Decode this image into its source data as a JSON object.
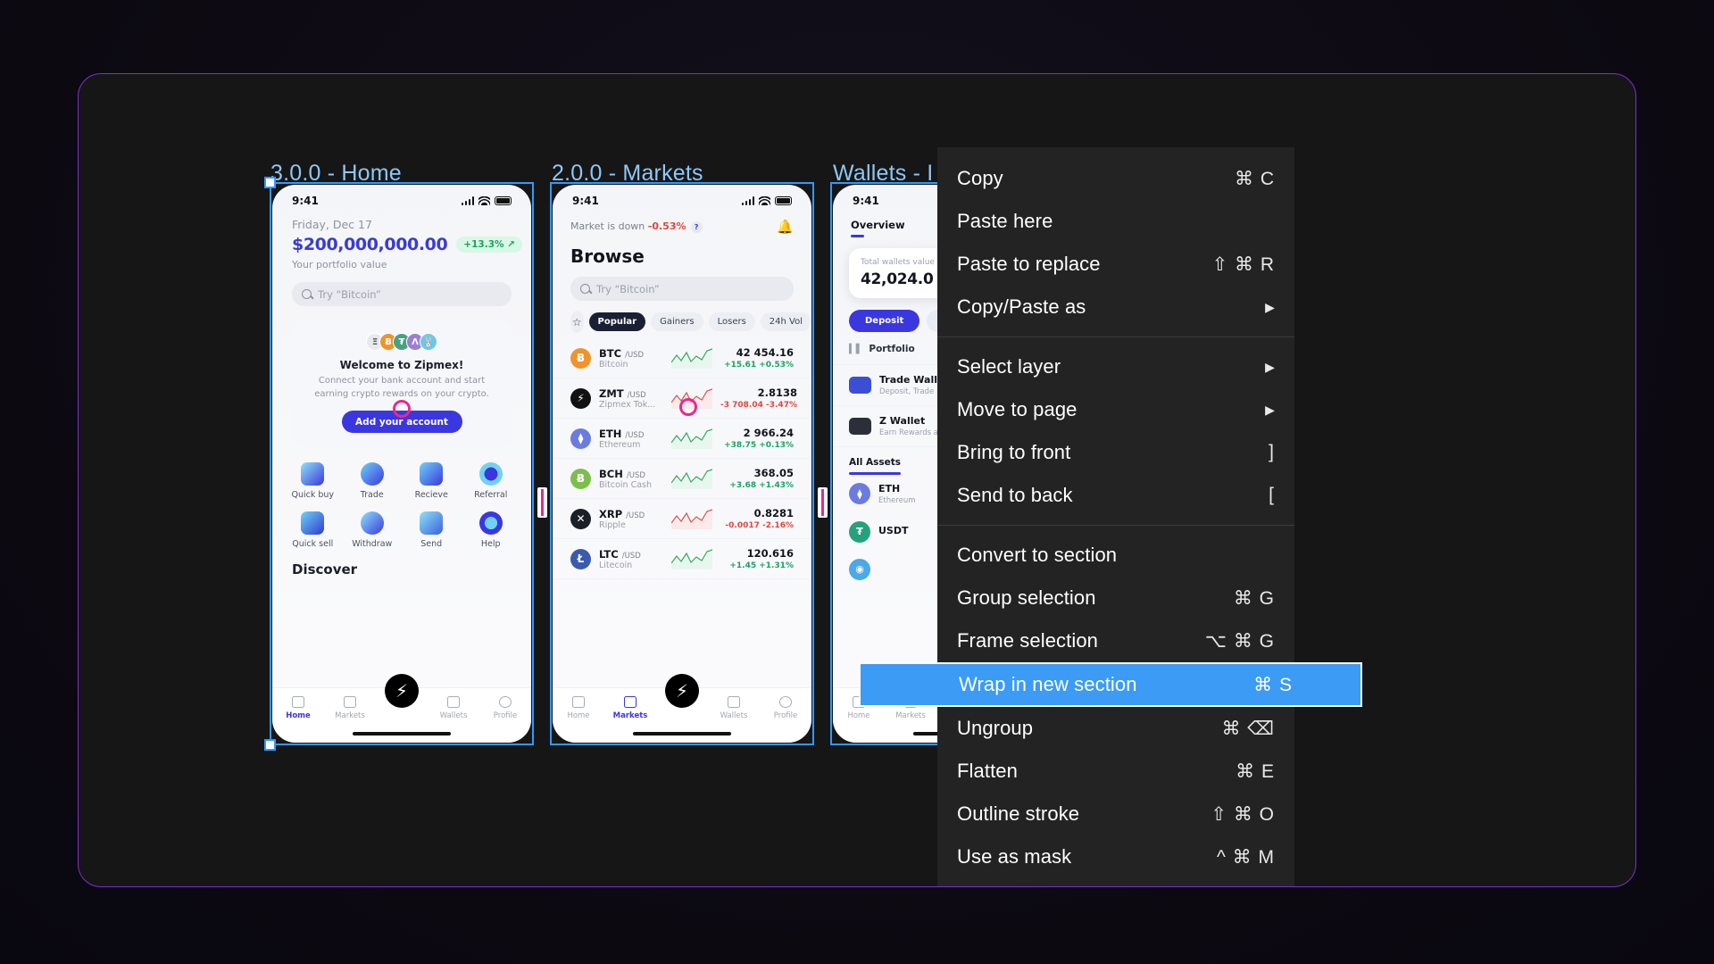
{
  "canvas": {
    "frame_border_color": "#7b2fd4",
    "background_color": "#161616",
    "selection_color": "#2e9bff",
    "marker_color": "#e8288e"
  },
  "frames": [
    {
      "label": "3.0.0 - Home"
    },
    {
      "label": "2.0.0 - Markets"
    },
    {
      "label": "Wallets - I"
    }
  ],
  "home": {
    "status": {
      "time": "9:41"
    },
    "date": "Friday, Dec 17",
    "portfolio_value": "$200,000,000.00",
    "change": "+13.3% ↗",
    "portfolio_caption": "Your portfolio value",
    "search_placeholder": "Try “Bitcoin”",
    "promo": {
      "title": "Welcome to Zipmex!",
      "body": "Connect your bank account and start earning crypto rewards on your crypto.",
      "cta": "Add your account",
      "coins": [
        {
          "glyph": "Ξ",
          "color": "#e8e9ec"
        },
        {
          "glyph": "Ƀ",
          "color": "#f0932b"
        },
        {
          "glyph": "₮",
          "color": "#4aa17f"
        },
        {
          "glyph": "Λ",
          "color": "#9b7fd4"
        },
        {
          "glyph": "🐰",
          "color": "#6cc8e8"
        }
      ]
    },
    "actions": [
      {
        "label": "Quick buy"
      },
      {
        "label": "Trade"
      },
      {
        "label": "Recieve"
      },
      {
        "label": "Referral"
      },
      {
        "label": "Quick sell"
      },
      {
        "label": "Withdraw"
      },
      {
        "label": "Send"
      },
      {
        "label": "Help"
      }
    ],
    "discover_heading": "Discover",
    "tabs": [
      {
        "label": "Home",
        "active": true
      },
      {
        "label": "Markets",
        "active": false
      },
      {
        "label": "Wallets",
        "active": false
      },
      {
        "label": "Profile",
        "active": false
      }
    ]
  },
  "markets": {
    "status": {
      "time": "9:41"
    },
    "market_status_prefix": "Market is down ",
    "market_status_value": "-0.53%",
    "help_badge": "?",
    "heading": "Browse",
    "search_placeholder": "Try “Bitcoin”",
    "chips": [
      {
        "label": "Popular",
        "active": true
      },
      {
        "label": "Gainers",
        "active": false
      },
      {
        "label": "Losers",
        "active": false
      },
      {
        "label": "24h Vol",
        "active": false
      }
    ],
    "coins": [
      {
        "symbol": "BTC",
        "pair": "/USD",
        "name": "Bitcoin",
        "price": "42 454.16",
        "change_abs": "+15.61",
        "change_pct": "+0.53%",
        "dir": "up",
        "dot_color": "#f0932b",
        "glyph": "Ƀ"
      },
      {
        "symbol": "ZMT",
        "pair": "/USD",
        "name": "Zipmex Tok...",
        "price": "2.8138",
        "change_abs": "-3 708.04",
        "change_pct": "-3.47%",
        "dir": "down",
        "dot_color": "#111111",
        "glyph": "⚡"
      },
      {
        "symbol": "ETH",
        "pair": "/USD",
        "name": "Ethereum",
        "price": "2 966.24",
        "change_abs": "+38.75",
        "change_pct": "+0.13%",
        "dir": "up",
        "dot_color": "#6a7ce0",
        "glyph": "⧫"
      },
      {
        "symbol": "BCH",
        "pair": "/USD",
        "name": "Bitcoin Cash",
        "price": "368.05",
        "change_abs": "+3.68",
        "change_pct": "+1.43%",
        "dir": "up",
        "dot_color": "#7cc04b",
        "glyph": "Ƀ"
      },
      {
        "symbol": "XRP",
        "pair": "/USD",
        "name": "Ripple",
        "price": "0.8281",
        "change_abs": "-0.0017",
        "change_pct": "-2.16%",
        "dir": "down",
        "dot_color": "#1b1f26",
        "glyph": "✕"
      },
      {
        "symbol": "LTC",
        "pair": "/USD",
        "name": "Litecoin",
        "price": "120.616",
        "change_abs": "+1.45",
        "change_pct": "+1.31%",
        "dir": "up",
        "dot_color": "#3a5ab0",
        "glyph": "Ł"
      }
    ],
    "tabs": [
      {
        "label": "Home",
        "active": false
      },
      {
        "label": "Markets",
        "active": true
      },
      {
        "label": "Wallets",
        "active": false
      },
      {
        "label": "Profile",
        "active": false
      }
    ]
  },
  "wallets": {
    "status": {
      "time": "9:41"
    },
    "tab_overview": "Overview",
    "total_label": "Total wallets value",
    "total_value": "42,024.0",
    "buttons": [
      {
        "label": "Deposit",
        "primary": true
      },
      {
        "label": "",
        "primary": false
      }
    ],
    "portfolio_label": "Portfolio",
    "items": [
      {
        "title": "Trade Walle",
        "subtitle": "Deposit, Trade ",
        "color": "#3b4fd6"
      },
      {
        "title": "Z Wallet",
        "subtitle": "Earn Rewards a",
        "color": "#2b2f3a"
      }
    ],
    "assets_label": "All Assets",
    "assets": [
      {
        "symbol": "ETH",
        "name": "Ethereum",
        "color": "#6a7ce0",
        "glyph": "⧫"
      },
      {
        "symbol": "USDT",
        "name": "",
        "color": "#26a17b",
        "glyph": "₮"
      }
    ],
    "tabs": [
      {
        "label": "Home",
        "active": false
      },
      {
        "label": "Markets",
        "active": false
      }
    ]
  },
  "context_menu": {
    "groups": [
      [
        {
          "label": "Copy",
          "shortcut": "⌘ C",
          "arrow": false,
          "highlighted": false
        },
        {
          "label": "Paste here",
          "shortcut": "",
          "arrow": false,
          "highlighted": false
        },
        {
          "label": "Paste to replace",
          "shortcut": "⇧ ⌘ R",
          "arrow": false,
          "highlighted": false
        },
        {
          "label": "Copy/Paste as",
          "shortcut": "",
          "arrow": true,
          "highlighted": false
        }
      ],
      [
        {
          "label": "Select layer",
          "shortcut": "",
          "arrow": true,
          "highlighted": false
        },
        {
          "label": "Move to page",
          "shortcut": "",
          "arrow": true,
          "highlighted": false
        },
        {
          "label": "Bring to front",
          "shortcut": "]",
          "arrow": false,
          "highlighted": false
        },
        {
          "label": "Send to back",
          "shortcut": "[",
          "arrow": false,
          "highlighted": false
        }
      ],
      [
        {
          "label": "Convert to section",
          "shortcut": "",
          "arrow": false,
          "highlighted": false
        },
        {
          "label": "Group selection",
          "shortcut": "⌘ G",
          "arrow": false,
          "highlighted": false
        },
        {
          "label": "Frame selection",
          "shortcut": "⌥ ⌘ G",
          "arrow": false,
          "highlighted": false
        },
        {
          "label": "Wrap in new section",
          "shortcut": "⌘ S",
          "arrow": false,
          "highlighted": true
        },
        {
          "label": "Ungroup",
          "shortcut": "⌘ ⌫",
          "arrow": false,
          "highlighted": false
        },
        {
          "label": "Flatten",
          "shortcut": "⌘ E",
          "arrow": false,
          "highlighted": false
        },
        {
          "label": "Outline stroke",
          "shortcut": "⇧ ⌘ O",
          "arrow": false,
          "highlighted": false
        },
        {
          "label": "Use as mask",
          "shortcut": "^ ⌘ M",
          "arrow": false,
          "highlighted": false
        }
      ]
    ]
  }
}
